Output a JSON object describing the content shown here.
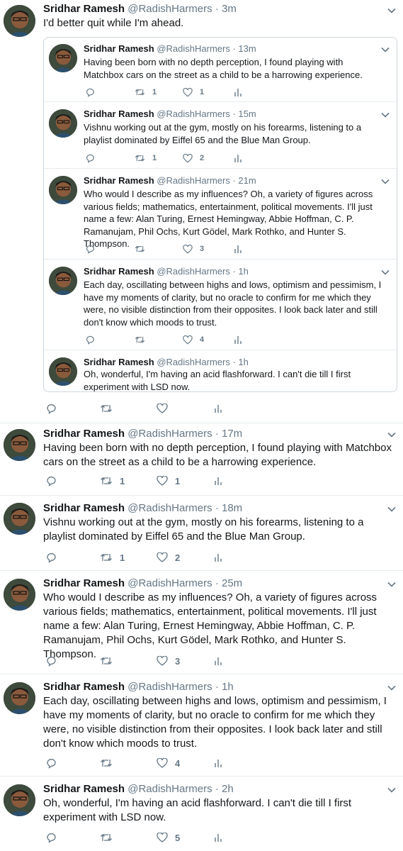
{
  "author": {
    "name": "Sridhar Ramesh",
    "handle": "@RadishHarmers"
  },
  "main_tweet": {
    "time": "3m",
    "text": "I'd better quit while I'm ahead.",
    "quoted": [
      {
        "time": "13m",
        "text": "Having been born with no depth perception, I found playing with Matchbox cars on the street as a child to be a harrowing experience.",
        "retweets": "1",
        "likes": "1"
      },
      {
        "time": "15m",
        "text": "Vishnu working out at the gym, mostly on his forearms, listening to a playlist dominated by Eiffel 65 and the Blue Man Group.",
        "retweets": "1",
        "likes": "2"
      },
      {
        "time": "21m",
        "text": "Who would I describe as my influences? Oh, a variety of figures across various fields; mathematics, entertainment, political movements. I'll just name a few: Alan Turing, Ernest Hemingway, Abbie Hoffman, C. P. Ramanujam, Phil Ochs, Kurt Gödel, Mark Rothko, and Hunter S. Thompson.",
        "retweets": "",
        "likes": "3"
      },
      {
        "time": "1h",
        "text": "Each day, oscillating between highs and lows, optimism and pessimism, I have my moments of clarity, but no oracle to confirm for me which they were, no visible distinction from their opposites. I look back later and still don't know which moods to trust.",
        "retweets": "",
        "likes": "4"
      },
      {
        "time": "1h",
        "text": "Oh, wonderful, I'm having an acid flashforward. I can't die till I first experiment with LSD now."
      }
    ],
    "retweets": "",
    "likes": ""
  },
  "tweets": [
    {
      "time": "17m",
      "text": "Having been born with no depth perception, I found playing with Matchbox cars on the street as a child to be a harrowing experience.",
      "retweets": "1",
      "likes": "1"
    },
    {
      "time": "18m",
      "text": "Vishnu working out at the gym, mostly on his forearms, listening to a playlist dominated by Eiffel 65 and the Blue Man Group.",
      "retweets": "1",
      "likes": "2"
    },
    {
      "time": "25m",
      "text": "Who would I describe as my influences? Oh, a variety of figures across various fields; mathematics, entertainment, political movements. I'll just name a few: Alan Turing, Ernest Hemingway, Abbie Hoffman, C. P. Ramanujam, Phil Ochs, Kurt Gödel, Mark Rothko, and Hunter S. Thompson.",
      "retweets": "",
      "likes": "3"
    },
    {
      "time": "1h",
      "text": "Each day, oscillating between highs and lows, optimism and pessimism, I have my moments of clarity, but no oracle to confirm for me which they were, no visible distinction from their opposites. I look back later and still don't know which moods to trust.",
      "retweets": "",
      "likes": "4"
    },
    {
      "time": "2h",
      "text": "Oh, wonderful, I'm having an acid flashforward. I can't die till I first experiment with LSD now.",
      "retweets": "",
      "likes": "5"
    }
  ],
  "icons": [
    "reply-icon",
    "retweet-icon",
    "like-icon",
    "analytics-icon",
    "chevron-down-icon"
  ],
  "colors": {
    "text": "#14171a",
    "muted": "#657786",
    "border": "#e6ecf0"
  }
}
